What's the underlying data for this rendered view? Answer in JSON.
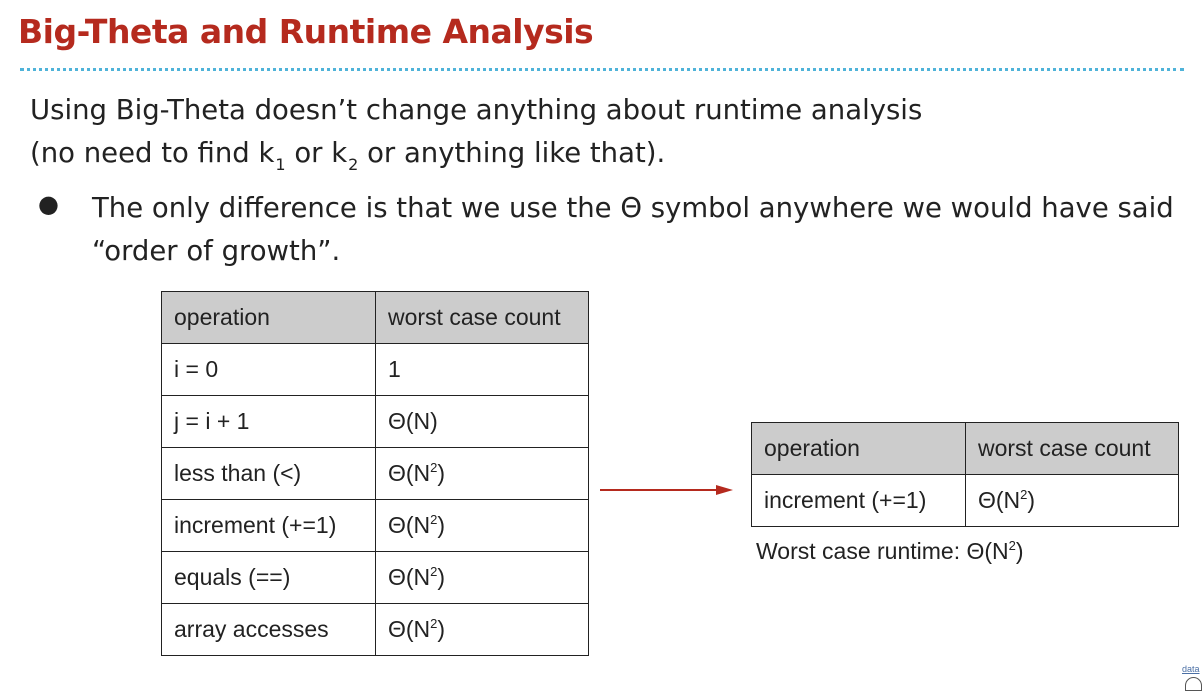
{
  "slide": {
    "title": "Big-Theta and Runtime Analysis",
    "intro_line1": "Using Big-Theta doesn’t change anything about runtime analysis",
    "intro_line2_pre": "(no need to find k",
    "intro_sub1": "1",
    "intro_line2_mid": " or k",
    "intro_sub2": "2",
    "intro_line2_post": " or anything like that).",
    "bullet": "The only difference is that we use the Θ symbol anywhere we would have said “order of growth”.",
    "bullet_symbol": "●"
  },
  "main_table": {
    "headers": [
      "operation",
      "worst case count"
    ],
    "rows": [
      {
        "operation": "i = 0",
        "count": "1",
        "exp": ""
      },
      {
        "operation": "j = i + 1",
        "count": "Θ(N)",
        "exp": ""
      },
      {
        "operation": "less than (<)",
        "count_base": "Θ(N",
        "exp": "2",
        "count_close": ")"
      },
      {
        "operation": "increment (+=1)",
        "count_base": "Θ(N",
        "exp": "2",
        "count_close": ")"
      },
      {
        "operation": "equals (==)",
        "count_base": "Θ(N",
        "exp": "2",
        "count_close": ")"
      },
      {
        "operation": "array accesses",
        "count_base": "Θ(N",
        "exp": "2",
        "count_close": ")"
      }
    ]
  },
  "result_table": {
    "headers": [
      "operation",
      "worst case count"
    ],
    "row": {
      "operation": "increment (+=1)",
      "count_base": "Θ(N",
      "exp": "2",
      "count_close": ")"
    }
  },
  "runtime": {
    "prefix": "Worst case runtime: Θ(N",
    "exp": "2",
    "suffix": ")"
  },
  "corner": {
    "label": "data"
  },
  "colors": {
    "title": "#b52a1e",
    "divider": "#4fb3d9",
    "arrow": "#b52a1e",
    "header_bg": "#cccccc"
  }
}
